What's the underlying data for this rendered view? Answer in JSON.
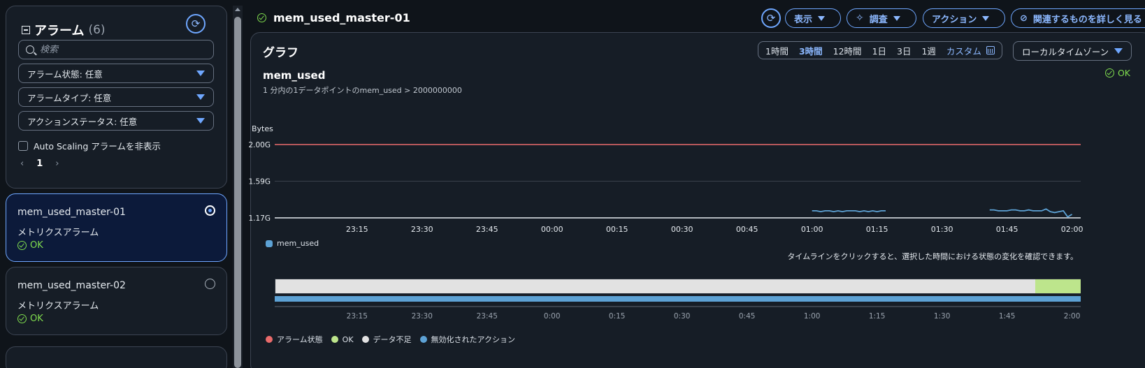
{
  "sidebar": {
    "title": "アラーム",
    "count": "(6)",
    "search_placeholder": "検索",
    "filters": [
      {
        "label": "アラーム状態: 任意"
      },
      {
        "label": "アラームタイプ: 任意"
      },
      {
        "label": "アクションステータス: 任意"
      }
    ],
    "hide_autoscaling_label": "Auto Scaling アラームを非表示",
    "page": "1",
    "alarms": [
      {
        "name": "mem_used_master-01",
        "type": "メトリクスアラーム",
        "status": "OK",
        "selected": true
      },
      {
        "name": "mem_used_master-02",
        "type": "メトリクスアラーム",
        "status": "OK",
        "selected": false
      }
    ]
  },
  "header": {
    "alarm_name": "mem_used_master-01",
    "buttons": {
      "view": "表示",
      "investigate": "調査",
      "actions": "アクション",
      "explore": "関連するものを詳しく見る"
    }
  },
  "graph": {
    "title": "グラフ",
    "time_ranges": [
      "1時間",
      "3時間",
      "12時間",
      "1日",
      "3日",
      "1週"
    ],
    "active_range": "3時間",
    "custom_label": "カスタム",
    "timezone": "ローカルタイムゾーン",
    "metric_title": "mem_used",
    "metric_desc": "1 分内の1データポイントのmem_used > 2000000000",
    "status": "OK",
    "timeline_hint": "タイムラインをクリックすると、選択した時間における状態の変化を確認できます。",
    "legend": {
      "alarm_state": "アラーム状態",
      "ok": "OK",
      "insufficient": "データ不足",
      "disabled_action": "無効化されたアクション"
    },
    "timeline_labels": [
      "23:15",
      "23:30",
      "23:45",
      "0:00",
      "0:15",
      "0:30",
      "0:45",
      "1:00",
      "1:15",
      "1:30",
      "1:45",
      "2:00"
    ]
  },
  "colors": {
    "accent": "#6fa7ff",
    "ok": "#7fdc4e",
    "threshold": "#e96b6b",
    "series": "#5da2d5",
    "insufficient": "#e2e2e2",
    "ok_band": "#bde58c"
  },
  "chart_data": {
    "type": "line",
    "ylabel": "Bytes",
    "y_tick_labels": [
      "1.17G",
      "1.59G",
      "2.00G"
    ],
    "ylim": [
      1.17,
      2.0
    ],
    "x_tick_labels": [
      "23:15",
      "23:30",
      "23:45",
      "00:00",
      "00:15",
      "00:30",
      "00:45",
      "01:00",
      "01:15",
      "01:30",
      "01:45",
      "02:00"
    ],
    "threshold": 2.0,
    "series": [
      {
        "name": "mem_used",
        "segments": [
          {
            "x": [
              "01:00",
              "01:01",
              "01:02",
              "01:03",
              "01:04",
              "01:05",
              "01:06",
              "01:07",
              "01:08",
              "01:09",
              "01:10",
              "01:11",
              "01:12",
              "01:13",
              "01:14",
              "01:15",
              "01:16",
              "01:17"
            ],
            "y": [
              1.25,
              1.25,
              1.24,
              1.25,
              1.25,
              1.24,
              1.25,
              1.24,
              1.25,
              1.25,
              1.25,
              1.24,
              1.25,
              1.24,
              1.25,
              1.24,
              1.25,
              1.25
            ]
          },
          {
            "x": [
              "01:41",
              "01:42",
              "01:43",
              "01:44",
              "01:45",
              "01:46",
              "01:47",
              "01:48",
              "01:49",
              "01:50",
              "01:51",
              "01:52",
              "01:53",
              "01:54",
              "01:55",
              "01:56",
              "01:57",
              "01:58",
              "01:59",
              "02:00"
            ],
            "y": [
              1.26,
              1.26,
              1.25,
              1.25,
              1.25,
              1.26,
              1.26,
              1.25,
              1.25,
              1.26,
              1.25,
              1.25,
              1.25,
              1.27,
              1.24,
              1.23,
              1.24,
              1.25,
              1.18,
              1.21
            ]
          }
        ]
      }
    ],
    "legend": [
      "mem_used"
    ],
    "grid": true
  }
}
